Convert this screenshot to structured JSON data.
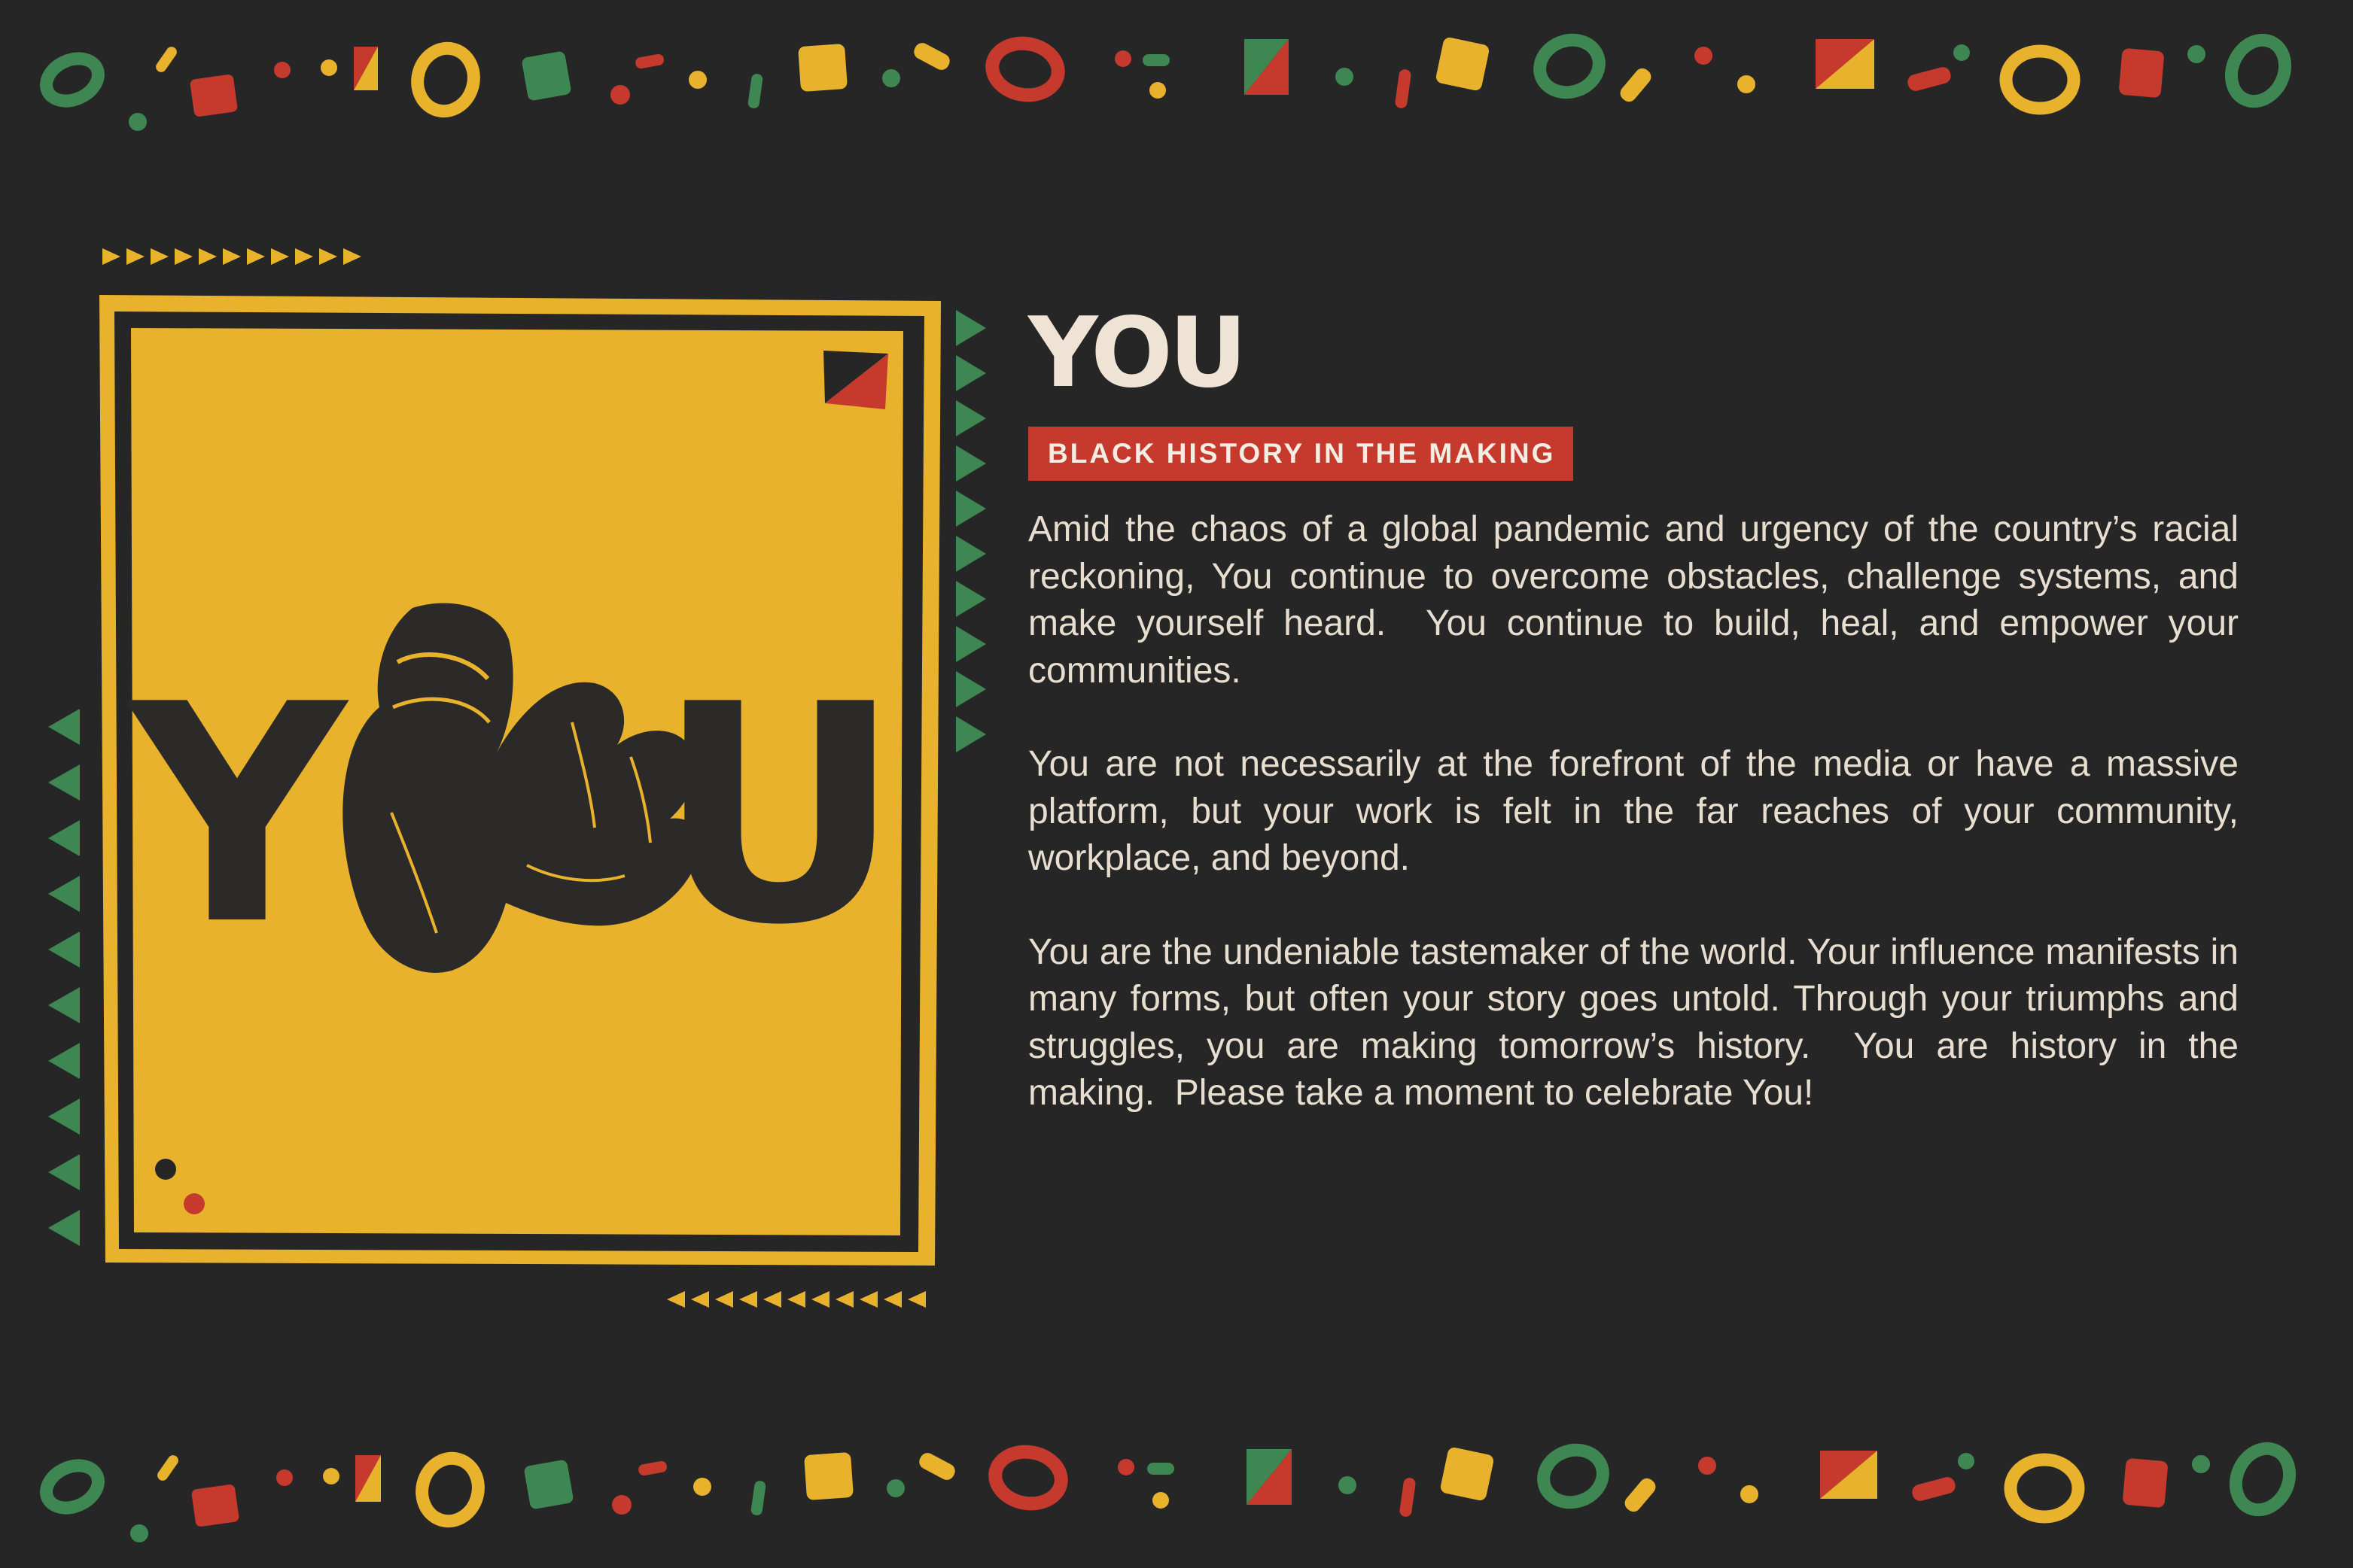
{
  "poster": {
    "word_left": "Y",
    "word_right": "U"
  },
  "article": {
    "title": "YOU",
    "subtitle": "BLACK HISTORY IN THE MAKING",
    "paragraphs": [
      "Amid the chaos of a global pandemic and urgency of the country’s racial reckoning, You continue to overcome obstacles, challenge systems, and make yourself heard.  You continue to build, heal, and empower your communities.",
      "You are not necessarily at the forefront of the media or have a massive platform, but your work is felt in the far reaches of your community, workplace, and beyond.",
      "You are the undeniable tastemaker of the world. Your influence manifests in many forms, but often your story goes untold. Through your triumphs and struggles, you are making tomorrow’s history.  You are history in the making.  Please take a moment to celebrate You!"
    ]
  },
  "palette": {
    "background": "#272626",
    "yellow": "#E9B22D",
    "red": "#C63A2E",
    "green": "#3E8752",
    "cream": "#EEE3D5",
    "ink": "#2B2A28"
  },
  "icons": {
    "pointing_hand": "pointing-hand-icon",
    "decor": "confetti-shapes"
  }
}
